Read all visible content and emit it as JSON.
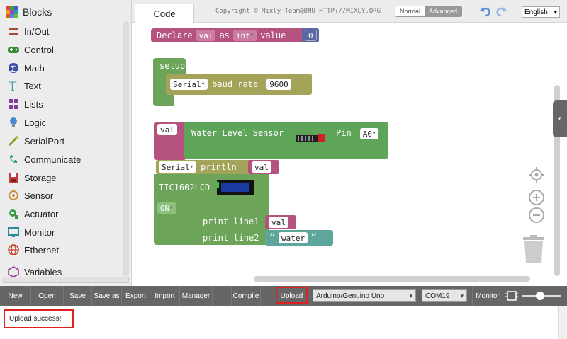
{
  "sidebar": {
    "title": "Blocks",
    "items": [
      {
        "label": "In/Out",
        "icon": "in-out-icon",
        "color": "#a0522d"
      },
      {
        "label": "Control",
        "icon": "gamepad-icon",
        "color": "#3a8a3a"
      },
      {
        "label": "Math",
        "icon": "math-icon",
        "color": "#3f4fa0"
      },
      {
        "label": "Text",
        "icon": "text-icon",
        "color": "#3aa0a0"
      },
      {
        "label": "Lists",
        "icon": "lists-icon",
        "color": "#7b3f9a"
      },
      {
        "label": "Logic",
        "icon": "bulb-icon",
        "color": "#4a8ad4"
      },
      {
        "label": "SerialPort",
        "icon": "serial-icon",
        "color": "#8aa02a"
      },
      {
        "label": "Communicate",
        "icon": "communicate-icon",
        "color": "#2a9a7a"
      },
      {
        "label": "Storage",
        "icon": "storage-icon",
        "color": "#c04040"
      },
      {
        "label": "Sensor",
        "icon": "sensor-icon",
        "color": "#c89040"
      },
      {
        "label": "Actuator",
        "icon": "actuator-icon",
        "color": "#3a9a4a"
      },
      {
        "label": "Monitor",
        "icon": "monitor-icon",
        "color": "#2a8a9a"
      },
      {
        "label": "Ethernet",
        "icon": "globe-icon",
        "color": "#c04020"
      },
      {
        "label": "Variables",
        "icon": "variables-icon",
        "color": "#9a3a9a"
      }
    ]
  },
  "topbar": {
    "tab_code": "Code",
    "copyright": "Copyright © Mixly Team@BNU HTTP://MIXLY.ORG",
    "mode_normal": "Normal",
    "mode_advanced": "Advanced",
    "language": "English"
  },
  "blocks": {
    "declare": {
      "label": "Declare",
      "var": "val",
      "as": "as",
      "type": "int",
      "value_label": "value",
      "value": "0"
    },
    "setup": {
      "label": "setup",
      "serial": "Serial",
      "baud_label": "baud rate",
      "baud": "9600"
    },
    "assign": {
      "var": "val",
      "sensor_label": "Water Level Sensor",
      "pin_label": "Pin",
      "pin": "A0"
    },
    "println": {
      "serial": "Serial",
      "label": "println",
      "var": "val"
    },
    "lcd": {
      "label": "IIC1602LCD",
      "state": "ON",
      "line1_label": "print line1",
      "line1_var": "val",
      "line2_label": "print line2",
      "line2_text": "water",
      "quote_open": "“",
      "quote_close": "”"
    }
  },
  "toolbar": {
    "new": "New",
    "open": "Open",
    "save": "Save",
    "save_as": "Save as",
    "export": "Export",
    "import": "Import",
    "manager": "Manager",
    "compile": "Compile",
    "upload": "Upload",
    "board": "Arduino/Genuino Uno",
    "port": "COM19",
    "monitor": "Monitor"
  },
  "status": {
    "message": "Upload success!"
  },
  "colors": {
    "var_block": "#b5527e",
    "setup_block": "#6ca55a",
    "serial_block": "#a3a35a",
    "text_block": "#5ea59b",
    "number_block": "#5b67a5",
    "sensor_block": "#5ea55a",
    "highlight": "#e02020"
  }
}
